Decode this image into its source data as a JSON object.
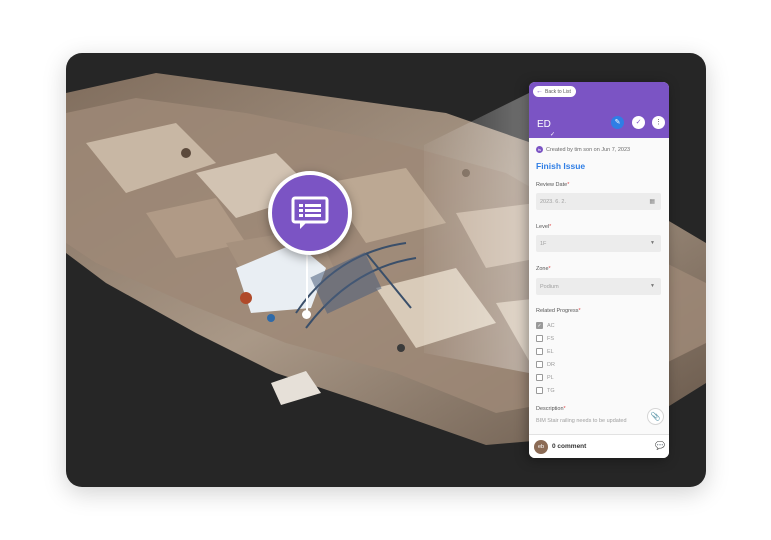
{
  "viewer": {
    "pin_icon": "issue-list-icon"
  },
  "panel": {
    "back_label": "Back to List",
    "issue_code": "ED",
    "header_icons": [
      "edit-icon",
      "check-icon",
      "more-icon"
    ],
    "created_initials": "ts",
    "created_text": "Created by tim son on Jun 7, 2023",
    "issue_title": "Finish Issue",
    "review_date": {
      "label": "Review Date",
      "value": "2023. 6. 2."
    },
    "level": {
      "label": "Level",
      "value": "1F"
    },
    "zone": {
      "label": "Zone",
      "value": "Podium"
    },
    "related_progress": {
      "label": "Related Progress",
      "items": [
        {
          "code": "AC",
          "checked": true
        },
        {
          "code": "FS",
          "checked": false
        },
        {
          "code": "EL",
          "checked": false
        },
        {
          "code": "DR",
          "checked": false
        },
        {
          "code": "PL",
          "checked": false
        },
        {
          "code": "TG",
          "checked": false
        }
      ]
    },
    "description": {
      "label": "Description",
      "value": "BIM Stair railing needs to be updated"
    },
    "footer": {
      "avatar_initials": "eb",
      "comment_count": "0 comment"
    },
    "colors": {
      "header": "#7b54c4",
      "accent": "#2f7ee5",
      "required": "#e24b4b"
    }
  }
}
